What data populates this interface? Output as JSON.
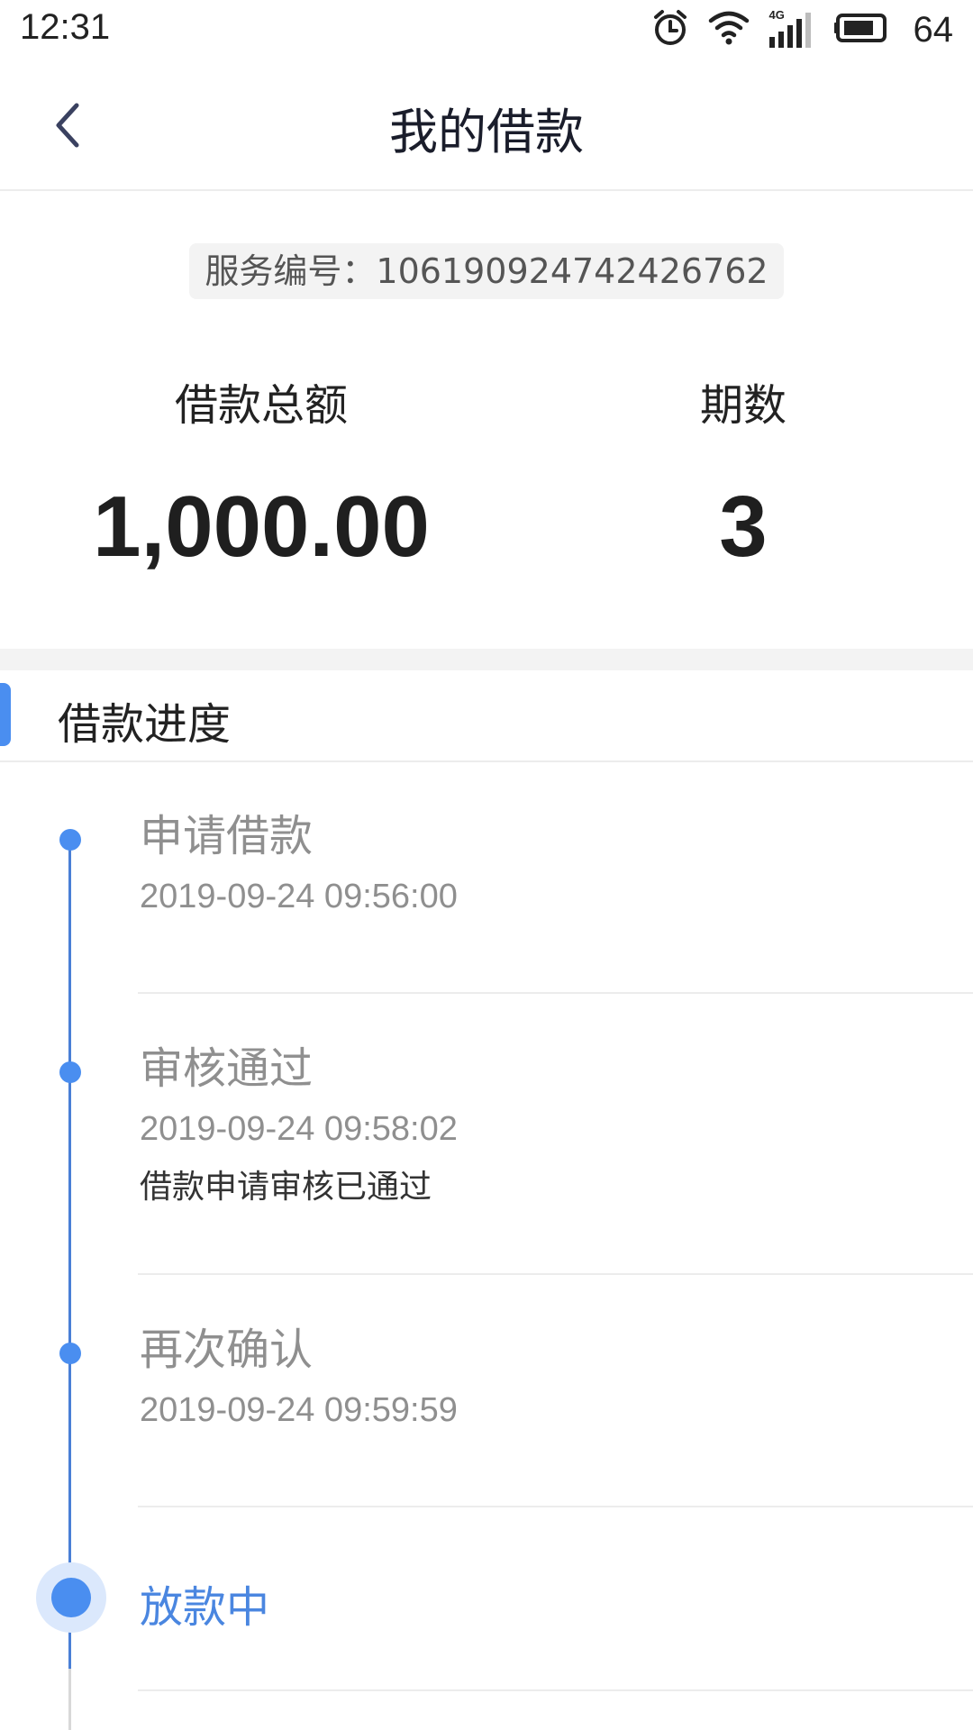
{
  "status_bar": {
    "time": "12:31",
    "network": "4G",
    "battery": "64",
    "icons": [
      "alarm-icon",
      "wifi-icon",
      "signal-icon",
      "battery-icon"
    ]
  },
  "nav": {
    "title": "我的借款",
    "back_icon": "chevron-left-icon"
  },
  "summary": {
    "service_number": "服务编号：1061909247424267​62",
    "total_label": "借款总额",
    "total_value": "1,000.00",
    "periods_label": "期数",
    "periods_value": "3"
  },
  "progress": {
    "title": "借款进度",
    "steps": [
      {
        "title": "申请借款",
        "time": "2019-09-24 09:56:00",
        "note": ""
      },
      {
        "title": "审核通过",
        "time": "2019-09-24 09:58:02",
        "note": "借款申请审核已通过"
      },
      {
        "title": "再次确认",
        "time": "2019-09-24 09:59:59",
        "note": ""
      },
      {
        "title": "放款中",
        "time": "",
        "note": ""
      }
    ]
  },
  "colors": {
    "accent": "#4a8ef0",
    "active_text": "#4a86e0",
    "muted_text": "#8f8f8f"
  }
}
